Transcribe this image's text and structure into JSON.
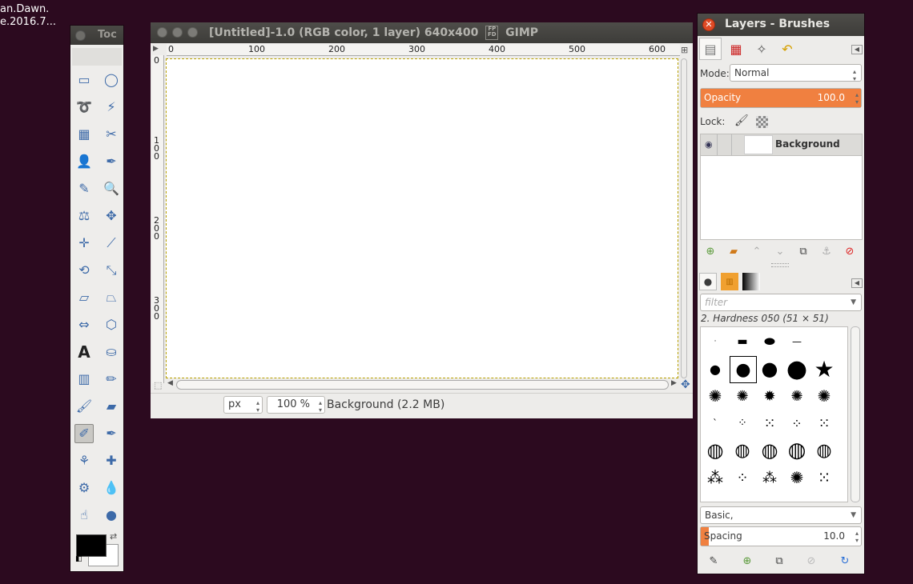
{
  "desktop": {
    "label_line1": "an.Dawn.",
    "label_line2": "e.2016.7..."
  },
  "toolbox": {
    "title": "Toc",
    "tools": [
      {
        "name": "rect-select",
        "glyph": "▭"
      },
      {
        "name": "ellipse-select",
        "glyph": "◯"
      },
      {
        "name": "free-select",
        "glyph": "➰"
      },
      {
        "name": "fuzzy-select",
        "glyph": "⚡"
      },
      {
        "name": "select-by-color",
        "glyph": "▦"
      },
      {
        "name": "scissors-select",
        "glyph": "✂"
      },
      {
        "name": "foreground-select",
        "glyph": "👤"
      },
      {
        "name": "paths",
        "glyph": "✒"
      },
      {
        "name": "color-picker",
        "glyph": "✎"
      },
      {
        "name": "zoom",
        "glyph": "🔍"
      },
      {
        "name": "measure",
        "glyph": "⚖"
      },
      {
        "name": "move",
        "glyph": "✥"
      },
      {
        "name": "alignment",
        "glyph": "✛"
      },
      {
        "name": "crop",
        "glyph": "⟋"
      },
      {
        "name": "rotate",
        "glyph": "⟲"
      },
      {
        "name": "scale",
        "glyph": "⤡"
      },
      {
        "name": "shear",
        "glyph": "▱"
      },
      {
        "name": "perspective",
        "glyph": "⏢"
      },
      {
        "name": "flip",
        "glyph": "⇔"
      },
      {
        "name": "cage-transform",
        "glyph": "⬡"
      },
      {
        "name": "text",
        "glyph": "A"
      },
      {
        "name": "bucket-fill",
        "glyph": "⛀"
      },
      {
        "name": "blend",
        "glyph": "▥"
      },
      {
        "name": "pencil",
        "glyph": "✏"
      },
      {
        "name": "paintbrush",
        "glyph": "🖌"
      },
      {
        "name": "eraser",
        "glyph": "▰"
      },
      {
        "name": "airbrush",
        "glyph": "✐"
      },
      {
        "name": "ink",
        "glyph": "✒"
      },
      {
        "name": "clone",
        "glyph": "⚘"
      },
      {
        "name": "heal",
        "glyph": "✚"
      },
      {
        "name": "perspective-clone",
        "glyph": "⚙"
      },
      {
        "name": "blur-sharpen",
        "glyph": "💧"
      },
      {
        "name": "smudge",
        "glyph": "☝"
      },
      {
        "name": "dodge-burn",
        "glyph": "●"
      }
    ]
  },
  "image_window": {
    "title": "[Untitled]-1.0 (RGB color, 1 layer) 640x400",
    "app_name": "GIMP",
    "ruler_h_ticks": [
      "0",
      "100",
      "200",
      "300",
      "400",
      "500",
      "600"
    ],
    "ruler_v_ticks": [
      "0",
      "1\n0\n0",
      "2\n0\n0",
      "3\n0\n0"
    ],
    "unit": "px",
    "zoom": "100 %",
    "status": "Background (2.2 MB)"
  },
  "dock": {
    "title": "Layers - Brushes",
    "mode_label": "Mode:",
    "mode_value": "Normal",
    "opacity_label": "Opacity",
    "opacity_value": "100.0",
    "opacity_percent": 100,
    "lock_label": "Lock:",
    "layer_name": "Background",
    "brush_filter_placeholder": "filter",
    "brush_name": "2. Hardness 050 (51 × 51)",
    "brush_tag": "Basic,",
    "spacing_label": "Spacing",
    "spacing_value": "10.0",
    "spacing_percent": 5
  }
}
